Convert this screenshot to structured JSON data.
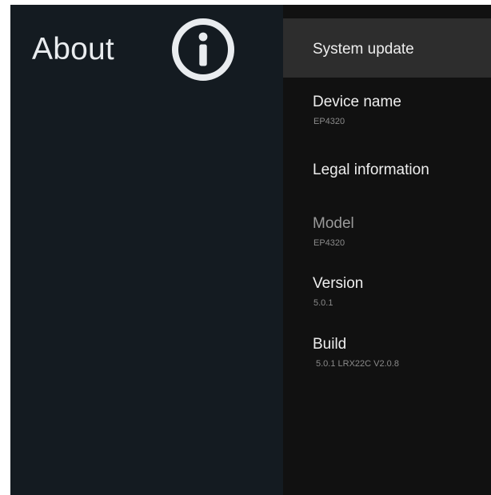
{
  "left_panel": {
    "title": "About",
    "icon": "info-icon"
  },
  "menu": {
    "items": [
      {
        "title": "System update",
        "subtitle": "",
        "selected": true,
        "enabled": true
      },
      {
        "title": "Device name",
        "subtitle": "EP4320",
        "selected": false,
        "enabled": true
      },
      {
        "title": "Legal information",
        "subtitle": "",
        "selected": false,
        "enabled": true
      },
      {
        "title": "Model",
        "subtitle": "EP4320",
        "selected": false,
        "enabled": false
      },
      {
        "title": "Version",
        "subtitle": "5.0.1",
        "selected": false,
        "enabled": true
      },
      {
        "title": "Build",
        "subtitle": "5.0.1 LRX22C V2.0.8",
        "selected": false,
        "enabled": true
      }
    ]
  },
  "colors": {
    "left_background": "#141b21",
    "right_background": "#111111",
    "selected_background": "#2d2d2d",
    "title_text": "#eeeeee",
    "disabled_text": "#9a9a9a",
    "secondary_text": "#8a8a8a"
  }
}
